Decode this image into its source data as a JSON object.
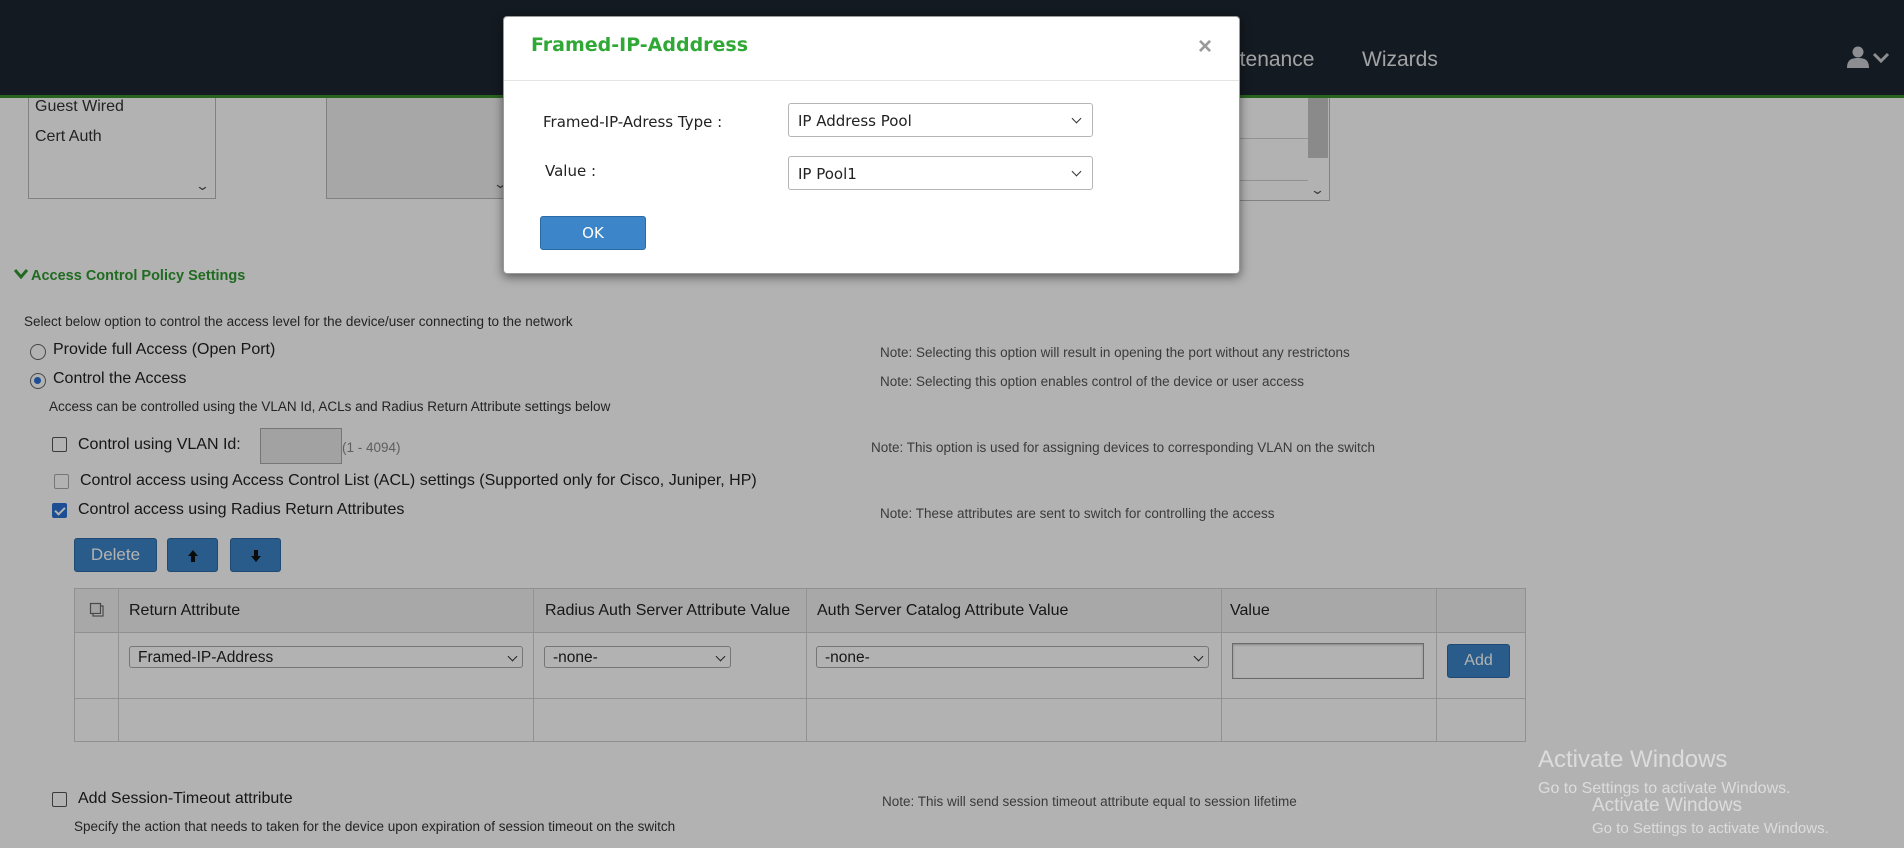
{
  "nav": {
    "links": [
      "ntenance",
      "Wizards"
    ]
  },
  "policy_list": {
    "items": [
      "Guest Wired",
      "Cert Auth"
    ]
  },
  "access_control": {
    "heading": "Access Control Policy Settings",
    "intro": "Select below option to control the access level for the device/user connecting to the network",
    "option_full": "Provide full Access (Open Port)",
    "option_control": "Control the Access",
    "control_desc": "Access can be controlled using the VLAN Id, ACLs and Radius Return Attribute settings below",
    "vlan_label": "Control using VLAN Id:",
    "vlan_range": "(1 - 4094)",
    "acl_label": "Control access using Access Control List (ACL) settings (Supported only for Cisco, Juniper, HP)",
    "radius_label": "Control access using Radius Return Attributes",
    "notes": {
      "full": "Note: Selecting this option will result in opening the port without any restrictons",
      "control": "Note: Selecting this option enables control of the device or user access",
      "vlan": "Note: This option is used for assigning devices to corresponding VLAN on the switch",
      "radius": "Note: These attributes are sent to switch for controlling the access",
      "session": "Note: This will send session timeout attribute equal to session lifetime"
    },
    "session_label": "Add Session-Timeout attribute",
    "session_desc": "Specify the action that needs to taken for the device upon expiration of session timeout on the switch"
  },
  "toolbar": {
    "delete_label": "Delete"
  },
  "table": {
    "headers": [
      "Return Attribute",
      "Radius Auth Server Attribute Value",
      "Auth Server Catalog Attribute Value",
      "Value"
    ],
    "row": {
      "return_attribute": "Framed-IP-Address",
      "radius_value": "-none-",
      "catalog_value": "-none-",
      "value": "",
      "add_label": "Add"
    }
  },
  "watermark": {
    "title": "Activate Windows",
    "subtitle": "Go to Settings to activate Windows."
  },
  "modal": {
    "title": "Framed-IP-Adddress",
    "close": "×",
    "type_label": "Framed-IP-Adress Type :",
    "type_value": "IP Address Pool",
    "value_label": "Value :",
    "value_value": "IP Pool1",
    "ok_label": "OK"
  }
}
